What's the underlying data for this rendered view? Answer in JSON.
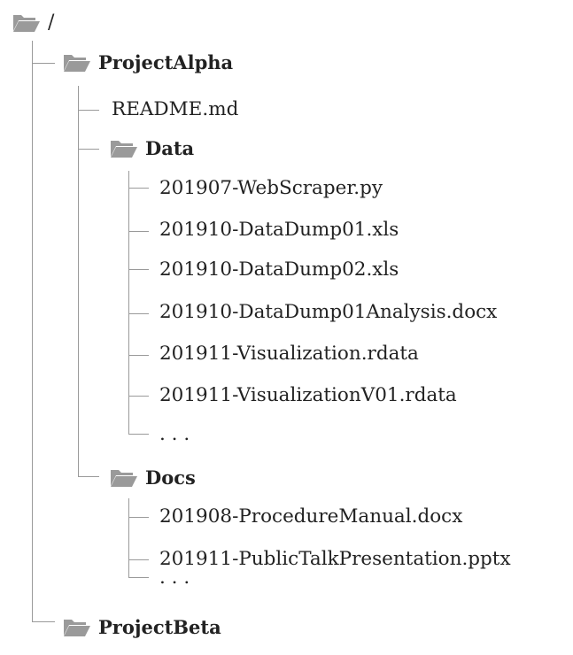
{
  "root": {
    "label": "/",
    "icon": "folder-open-icon"
  },
  "folders": {
    "project_alpha": {
      "label": "ProjectAlpha",
      "icon": "folder-open-icon",
      "items": {
        "readme": "README.md",
        "data": {
          "label": "Data",
          "icon": "folder-open-icon",
          "files": [
            "201907-WebScraper.py",
            "201910-DataDump01.xls",
            "201910-DataDump02.xls",
            "201910-DataDump01Analysis.docx",
            "201911-Visualization.rdata",
            "201911-VisualizationV01.rdata",
            ". . ."
          ]
        },
        "docs": {
          "label": "Docs",
          "icon": "folder-open-icon",
          "files": [
            "201908-ProcedureManual.docx",
            "201911-PublicTalkPresentation.pptx",
            ". . ."
          ]
        }
      }
    },
    "project_beta": {
      "label": "ProjectBeta",
      "icon": "folder-open-icon"
    }
  },
  "colors": {
    "folder": "#9a9a9a",
    "lines": "#9a9a9a",
    "text": "#222222"
  }
}
